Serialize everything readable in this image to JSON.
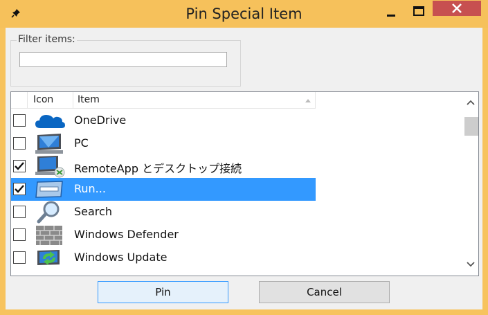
{
  "window": {
    "title": "Pin Special Item",
    "controls": [
      "minimize-icon",
      "maximize-icon",
      "close-icon"
    ],
    "accent": "#f6c15b"
  },
  "filter": {
    "label": "Filter items:",
    "value": "",
    "placeholder": ""
  },
  "list": {
    "columns": {
      "icon": "Icon",
      "item": "Item"
    },
    "rows": [
      {
        "label": "OneDrive",
        "checked": false,
        "selected": false,
        "icon": "onedrive-cloud-icon"
      },
      {
        "label": "PC",
        "checked": false,
        "selected": false,
        "icon": "computer-monitor-icon"
      },
      {
        "label": "RemoteApp とデスクトップ接続",
        "checked": true,
        "selected": false,
        "icon": "remote-desktop-icon"
      },
      {
        "label": "Run...",
        "checked": true,
        "selected": true,
        "icon": "run-dialog-icon"
      },
      {
        "label": "Search",
        "checked": false,
        "selected": false,
        "icon": "magnifier-search-icon"
      },
      {
        "label": "Windows Defender",
        "checked": false,
        "selected": false,
        "icon": "defender-wall-icon"
      },
      {
        "label": "Windows Update",
        "checked": false,
        "selected": false,
        "icon": "windows-update-icon"
      }
    ],
    "selection_color": "#3399ff"
  },
  "buttons": {
    "pin": "Pin",
    "cancel": "Cancel"
  }
}
